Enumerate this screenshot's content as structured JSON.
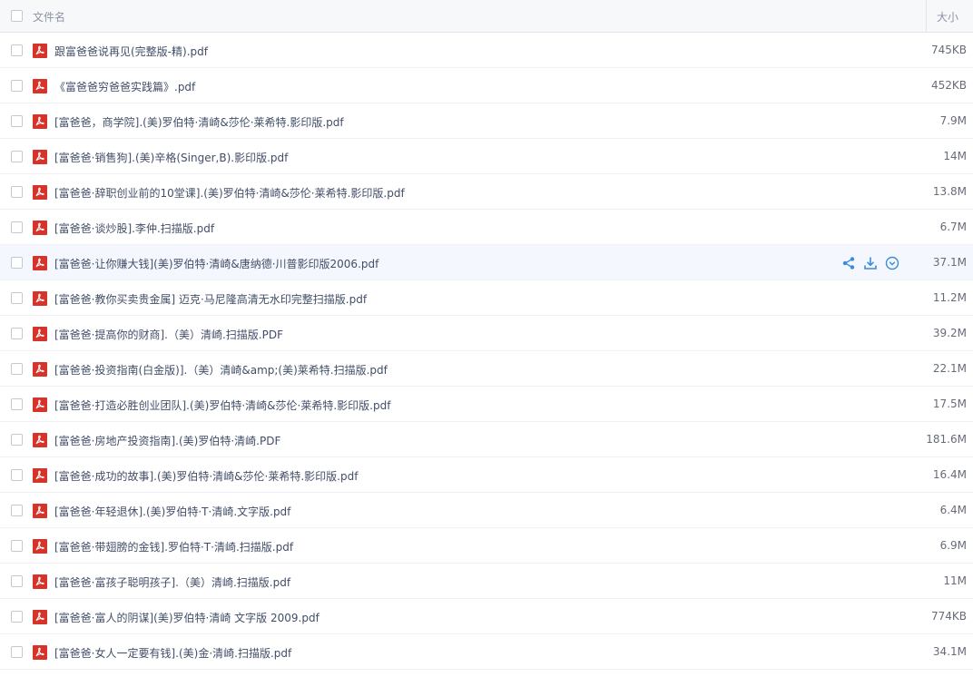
{
  "header": {
    "name_label": "文件名",
    "size_label": "大小"
  },
  "colors": {
    "pdf_icon": "#d6342b",
    "hover_row": "#f4f8fe",
    "action_icons": "#3b8cd8"
  },
  "hover_row_actions": [
    "share-icon",
    "download-icon",
    "more-icon"
  ],
  "files": [
    {
      "name": "跟富爸爸说再见(完整版-精).pdf",
      "size": "745KB"
    },
    {
      "name": "《富爸爸穷爸爸实践篇》.pdf",
      "size": "452KB"
    },
    {
      "name": "[富爸爸，商学院].(美)罗伯特·清崎&莎伦·莱希特.影印版.pdf",
      "size": "7.9M"
    },
    {
      "name": "[富爸爸·销售狗].(美)辛格(Singer,B).影印版.pdf",
      "size": "14M"
    },
    {
      "name": "[富爸爸·辞职创业前的10堂课].(美)罗伯特·清崎&莎伦·莱希特.影印版.pdf",
      "size": "13.8M"
    },
    {
      "name": "[富爸爸·谈炒股].李仲.扫描版.pdf",
      "size": "6.7M"
    },
    {
      "name": "[富爸爸·让你赚大钱](美)罗伯特·清崎&唐纳德·川普影印版2006.pdf",
      "size": "37.1M"
    },
    {
      "name": "[富爸爸·教你买卖贵金属] 迈克·马尼隆高清无水印完整扫描版.pdf",
      "size": "11.2M"
    },
    {
      "name": "[富爸爸·提高你的财商].（美）清崎.扫描版.PDF",
      "size": "39.2M"
    },
    {
      "name": "[富爸爸·投资指南(白金版)].（美）清崎&amp;(美)莱希特.扫描版.pdf",
      "size": "22.1M"
    },
    {
      "name": "[富爸爸·打造必胜创业团队].(美)罗伯特·清崎&莎伦·莱希特.影印版.pdf",
      "size": "17.5M"
    },
    {
      "name": "[富爸爸·房地产投资指南].(美)罗伯特·清崎.PDF",
      "size": "181.6M"
    },
    {
      "name": "[富爸爸·成功的故事].(美)罗伯特·清崎&莎伦·莱希特.影印版.pdf",
      "size": "16.4M"
    },
    {
      "name": "[富爸爸·年轻退休].(美)罗伯特·T·清崎.文字版.pdf",
      "size": "6.4M"
    },
    {
      "name": "[富爸爸·带翅膀的金钱].罗伯特·T·清崎.扫描版.pdf",
      "size": "6.9M"
    },
    {
      "name": "[富爸爸·富孩子聪明孩子].（美）清崎.扫描版.pdf",
      "size": "11M"
    },
    {
      "name": "[富爸爸·富人的阴谋](美)罗伯特·清崎 文字版 2009.pdf",
      "size": "774KB"
    },
    {
      "name": "[富爸爸·女人一定要有钱].(美)金·清崎.扫描版.pdf",
      "size": "34.1M"
    }
  ]
}
